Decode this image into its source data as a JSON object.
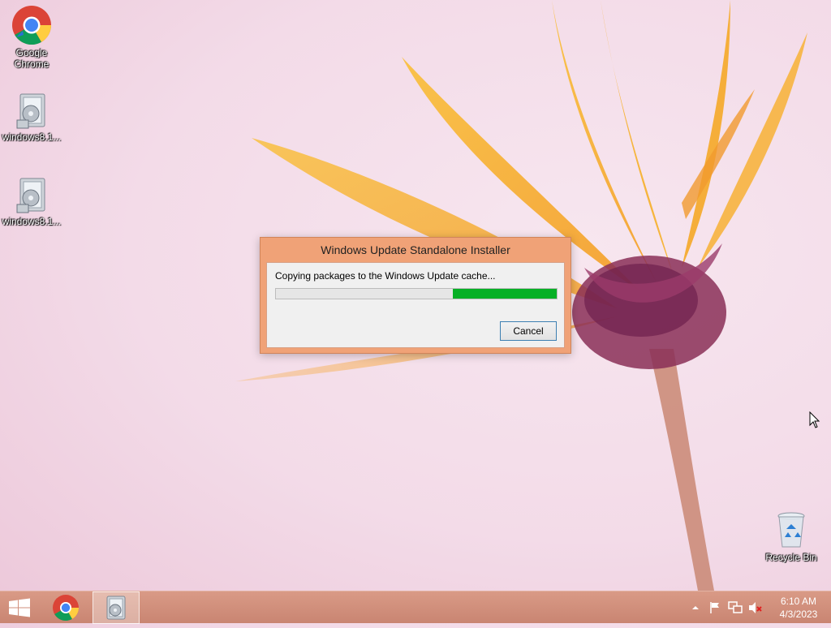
{
  "desktop": {
    "icons": [
      {
        "label_line1": "Google",
        "label_line2": "Chrome",
        "icon": "chrome-icon"
      },
      {
        "label": "windows8.1...",
        "icon": "installer-package-icon"
      },
      {
        "label": "windows8.1...",
        "icon": "installer-package-icon"
      },
      {
        "label": "Recycle Bin",
        "icon": "recycle-bin-icon"
      }
    ]
  },
  "dialog": {
    "title": "Windows Update Standalone Installer",
    "message": "Copying packages to the Windows Update cache...",
    "progress_fraction": 0.37,
    "cancel_label": "Cancel",
    "accent_color": "#f0a277",
    "progress_color": "#06b025"
  },
  "taskbar": {
    "pinned": [
      {
        "name": "start",
        "icon": "windows-logo-icon"
      },
      {
        "name": "chrome",
        "icon": "chrome-icon"
      },
      {
        "name": "installer",
        "icon": "installer-package-icon",
        "active": true
      }
    ],
    "tray": {
      "icons": [
        "chevron-up-icon",
        "flag-icon",
        "network-icon",
        "speaker-muted-icon"
      ]
    },
    "clock": {
      "time": "6:10 AM",
      "date": "4/3/2023"
    }
  }
}
